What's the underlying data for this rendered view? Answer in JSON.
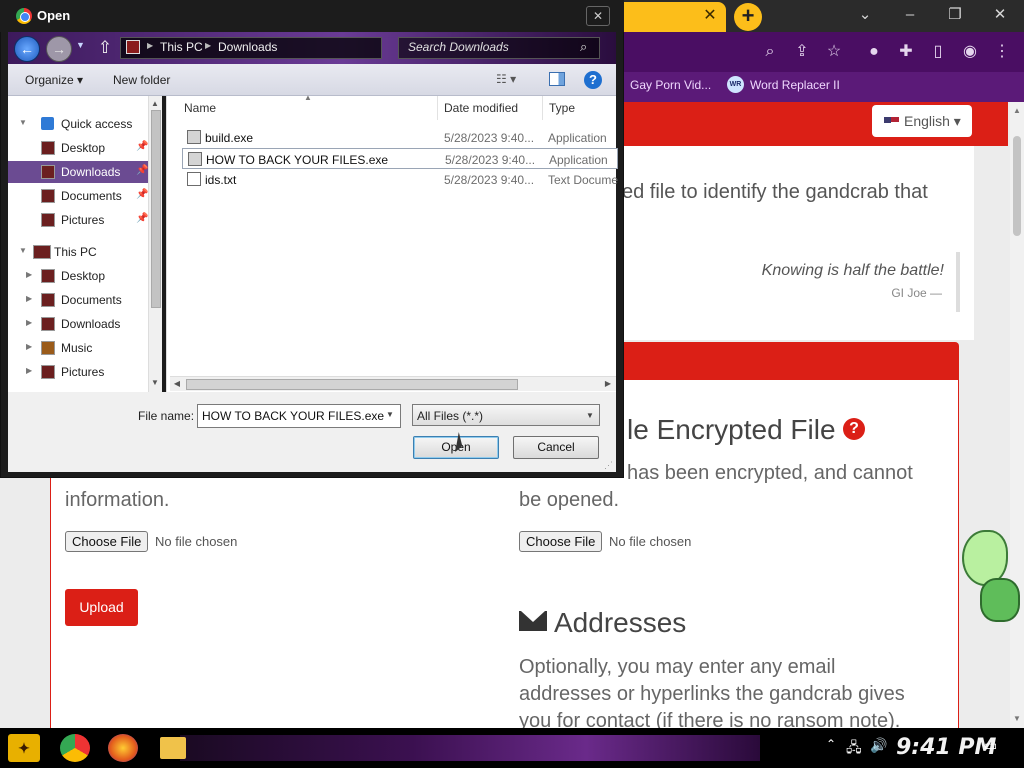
{
  "browser": {
    "bookmarks": [
      "Gay Porn Vid...",
      "Word Replacer II"
    ],
    "bookmark_badge": "WR",
    "language": "English",
    "intro_line": "ed file to identify the gandcrab that",
    "quote": "Knowing is half the battle!",
    "quote_source": "GI Joe —",
    "encrypted_title": "le Encrypted File",
    "encrypted_desc": [
      "has been encrypted, and cannot",
      "be opened."
    ],
    "left_desc": "information.",
    "choose_file": "Choose File",
    "no_file": "No file chosen",
    "upload": "Upload",
    "addresses_title": "Addresses",
    "addresses_desc": [
      "Optionally, you may enter any email",
      "addresses or hyperlinks the gandcrab gives",
      "you for contact (if there is no ransom note)."
    ]
  },
  "taskbar": {
    "clock": "9:41 PM"
  },
  "dialog": {
    "title": "Open",
    "breadcrumb": [
      "This PC",
      "Downloads"
    ],
    "search_placeholder": "Search Downloads",
    "organize": "Organize ▾",
    "new_folder": "New folder",
    "nav": [
      {
        "label": "Quick access",
        "level": 0,
        "selected": false
      },
      {
        "label": "Desktop",
        "level": 1,
        "pinned": true,
        "selected": false
      },
      {
        "label": "Downloads",
        "level": 1,
        "pinned": true,
        "selected": true
      },
      {
        "label": "Documents",
        "level": 1,
        "pinned": true,
        "selected": false
      },
      {
        "label": "Pictures",
        "level": 1,
        "pinned": true,
        "selected": false
      },
      {
        "label": "This PC",
        "level": 0,
        "selected": false
      },
      {
        "label": "Desktop",
        "level": 1,
        "selected": false
      },
      {
        "label": "Documents",
        "level": 1,
        "selected": false
      },
      {
        "label": "Downloads",
        "level": 1,
        "selected": false
      },
      {
        "label": "Music",
        "level": 1,
        "selected": false
      },
      {
        "label": "Pictures",
        "level": 1,
        "selected": false
      }
    ],
    "columns": {
      "name": "Name",
      "date": "Date modified",
      "type": "Type"
    },
    "files": [
      {
        "name": "build.exe",
        "date": "5/28/2023 9:40...",
        "type": "Application"
      },
      {
        "name": "HOW TO BACK YOUR FILES.exe",
        "date": "5/28/2023 9:40...",
        "type": "Application"
      },
      {
        "name": "ids.txt",
        "date": "5/28/2023 9:40...",
        "type": "Text Document"
      }
    ],
    "file_name_label": "File name:",
    "file_name_value": "HOW TO BACK YOUR FILES.exe",
    "file_type": "All Files (*.*)",
    "open_btn": "Open",
    "cancel_btn": "Cancel"
  }
}
